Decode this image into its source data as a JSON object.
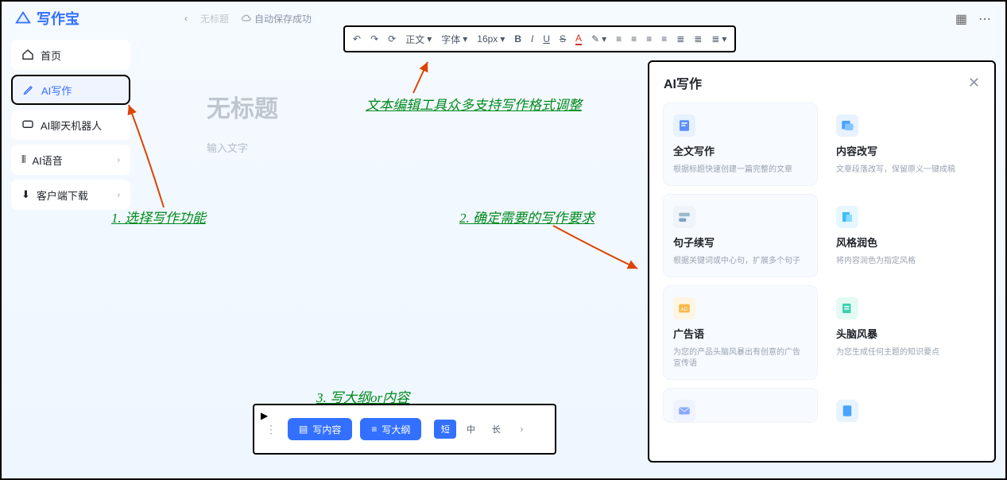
{
  "app": {
    "name": "写作宝"
  },
  "header": {
    "back_label": "‹",
    "untitled": "无标题",
    "autosave_label": "自动保存成功"
  },
  "sidebar": {
    "items": [
      {
        "label": "首页"
      },
      {
        "label": "AI写作"
      },
      {
        "label": "AI聊天机器人"
      },
      {
        "label": "AI语音"
      },
      {
        "label": "客户端下载"
      }
    ]
  },
  "toolbar": {
    "undo": "↶",
    "redo": "↷",
    "format": "⟳",
    "heading_label": "正文",
    "font_label": "字体",
    "size_label": "16px",
    "bold": "B",
    "italic": "I",
    "underline": "U",
    "strike": "S",
    "textcolor": "A",
    "pencil": "✎"
  },
  "editor": {
    "title_placeholder": "无标题",
    "body_placeholder": "输入文字"
  },
  "ai_panel": {
    "title": "AI写作",
    "cards": [
      {
        "title": "全文写作",
        "desc": "根据标题快速创建一篇完整的文章",
        "color": "#5b8ff9"
      },
      {
        "title": "内容改写",
        "desc": "文章段落改写，保留原义一键成稿",
        "color": "#4aa3ff"
      },
      {
        "title": "句子续写",
        "desc": "根据关键词或中心句，扩展多个句子",
        "color": "#7aa6c9"
      },
      {
        "title": "风格润色",
        "desc": "将内容润色为指定风格",
        "color": "#3fbcf7"
      },
      {
        "title": "广告语",
        "desc": "为您的产品头脑风暴出有创意的广告宣传语",
        "color": "#f7b94a"
      },
      {
        "title": "头脑风暴",
        "desc": "为您生成任何主题的知识要点",
        "color": "#3fd0b0"
      }
    ]
  },
  "bottom": {
    "write_content": "写内容",
    "write_outline": "写大纲",
    "len": [
      "短",
      "中",
      "长"
    ]
  },
  "annotations": {
    "a1": "1. 选择写作功能",
    "a2": "2. 确定需要的写作要求",
    "a3": "3. 写大纲or内容",
    "toolbar_note": "文本编辑工具众多支持写作格式调整"
  }
}
